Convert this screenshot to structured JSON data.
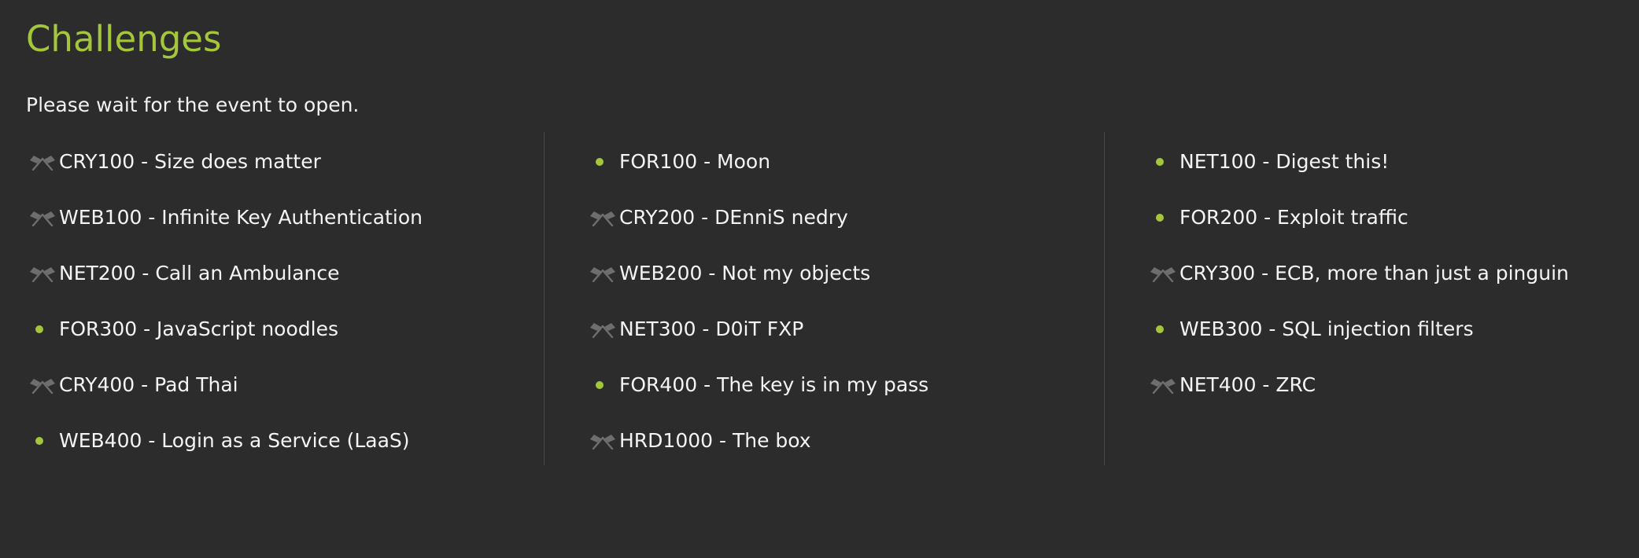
{
  "page": {
    "title": "Challenges",
    "notice": "Please wait for the event to open."
  },
  "colors": {
    "background": "#2c2c2c",
    "accent": "#a4c63b",
    "text": "#f4f4f4",
    "flag_icon": "#6e6e6e",
    "divider": "#4a4a4a"
  },
  "columns": [
    {
      "items": [
        {
          "label": "CRY100 - Size does matter",
          "icon": "crossed-flags-icon"
        },
        {
          "label": "WEB100 - Infinite Key Authentication",
          "icon": "crossed-flags-icon"
        },
        {
          "label": "NET200 - Call an Ambulance",
          "icon": "crossed-flags-icon"
        },
        {
          "label": "FOR300 - JavaScript noodles",
          "icon": "green-dot-icon"
        },
        {
          "label": "CRY400 - Pad Thai",
          "icon": "crossed-flags-icon"
        },
        {
          "label": "WEB400 - Login as a Service (LaaS)",
          "icon": "green-dot-icon"
        }
      ]
    },
    {
      "items": [
        {
          "label": "FOR100 - Moon",
          "icon": "green-dot-icon"
        },
        {
          "label": "CRY200 - DEnniS nedry",
          "icon": "crossed-flags-icon"
        },
        {
          "label": "WEB200 - Not my objects",
          "icon": "crossed-flags-icon"
        },
        {
          "label": "NET300 - D0iT FXP",
          "icon": "crossed-flags-icon"
        },
        {
          "label": "FOR400 - The key is in my pass",
          "icon": "green-dot-icon"
        },
        {
          "label": "HRD1000 - The box",
          "icon": "crossed-flags-icon"
        }
      ]
    },
    {
      "items": [
        {
          "label": "NET100 - Digest this!",
          "icon": "green-dot-icon"
        },
        {
          "label": "FOR200 - Exploit traffic",
          "icon": "green-dot-icon"
        },
        {
          "label": "CRY300 - ECB, more than just a pinguin",
          "icon": "crossed-flags-icon"
        },
        {
          "label": "WEB300 - SQL injection filters",
          "icon": "green-dot-icon"
        },
        {
          "label": "NET400 - ZRC",
          "icon": "crossed-flags-icon"
        }
      ]
    }
  ]
}
